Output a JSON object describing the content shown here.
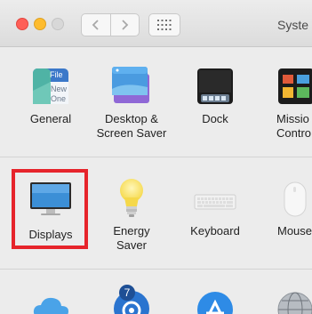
{
  "window": {
    "title": "Syste"
  },
  "row1": [
    {
      "key": "general",
      "label": "General",
      "icon_text": [
        "File",
        "New",
        "One"
      ]
    },
    {
      "key": "desktop-screen-saver",
      "label": "Desktop &\nScreen Saver"
    },
    {
      "key": "dock",
      "label": "Dock"
    },
    {
      "key": "mission-control",
      "label": "Missio\nContro"
    }
  ],
  "row2": [
    {
      "key": "displays",
      "label": "Displays",
      "selected": true
    },
    {
      "key": "energy-saver",
      "label": "Energy\nSaver"
    },
    {
      "key": "keyboard",
      "label": "Keyboard"
    },
    {
      "key": "mouse",
      "label": "Mouse"
    }
  ],
  "row3": [
    {
      "key": "icloud",
      "icon": "cloud-icon"
    },
    {
      "key": "internet-accounts",
      "icon": "at-sign-icon",
      "badge": "7"
    },
    {
      "key": "app-store",
      "icon": "app-store-icon"
    },
    {
      "key": "network",
      "icon": "globe-icon"
    }
  ],
  "colors": {
    "highlight": "#e6242b",
    "accent_blue": "#2f7de1"
  }
}
